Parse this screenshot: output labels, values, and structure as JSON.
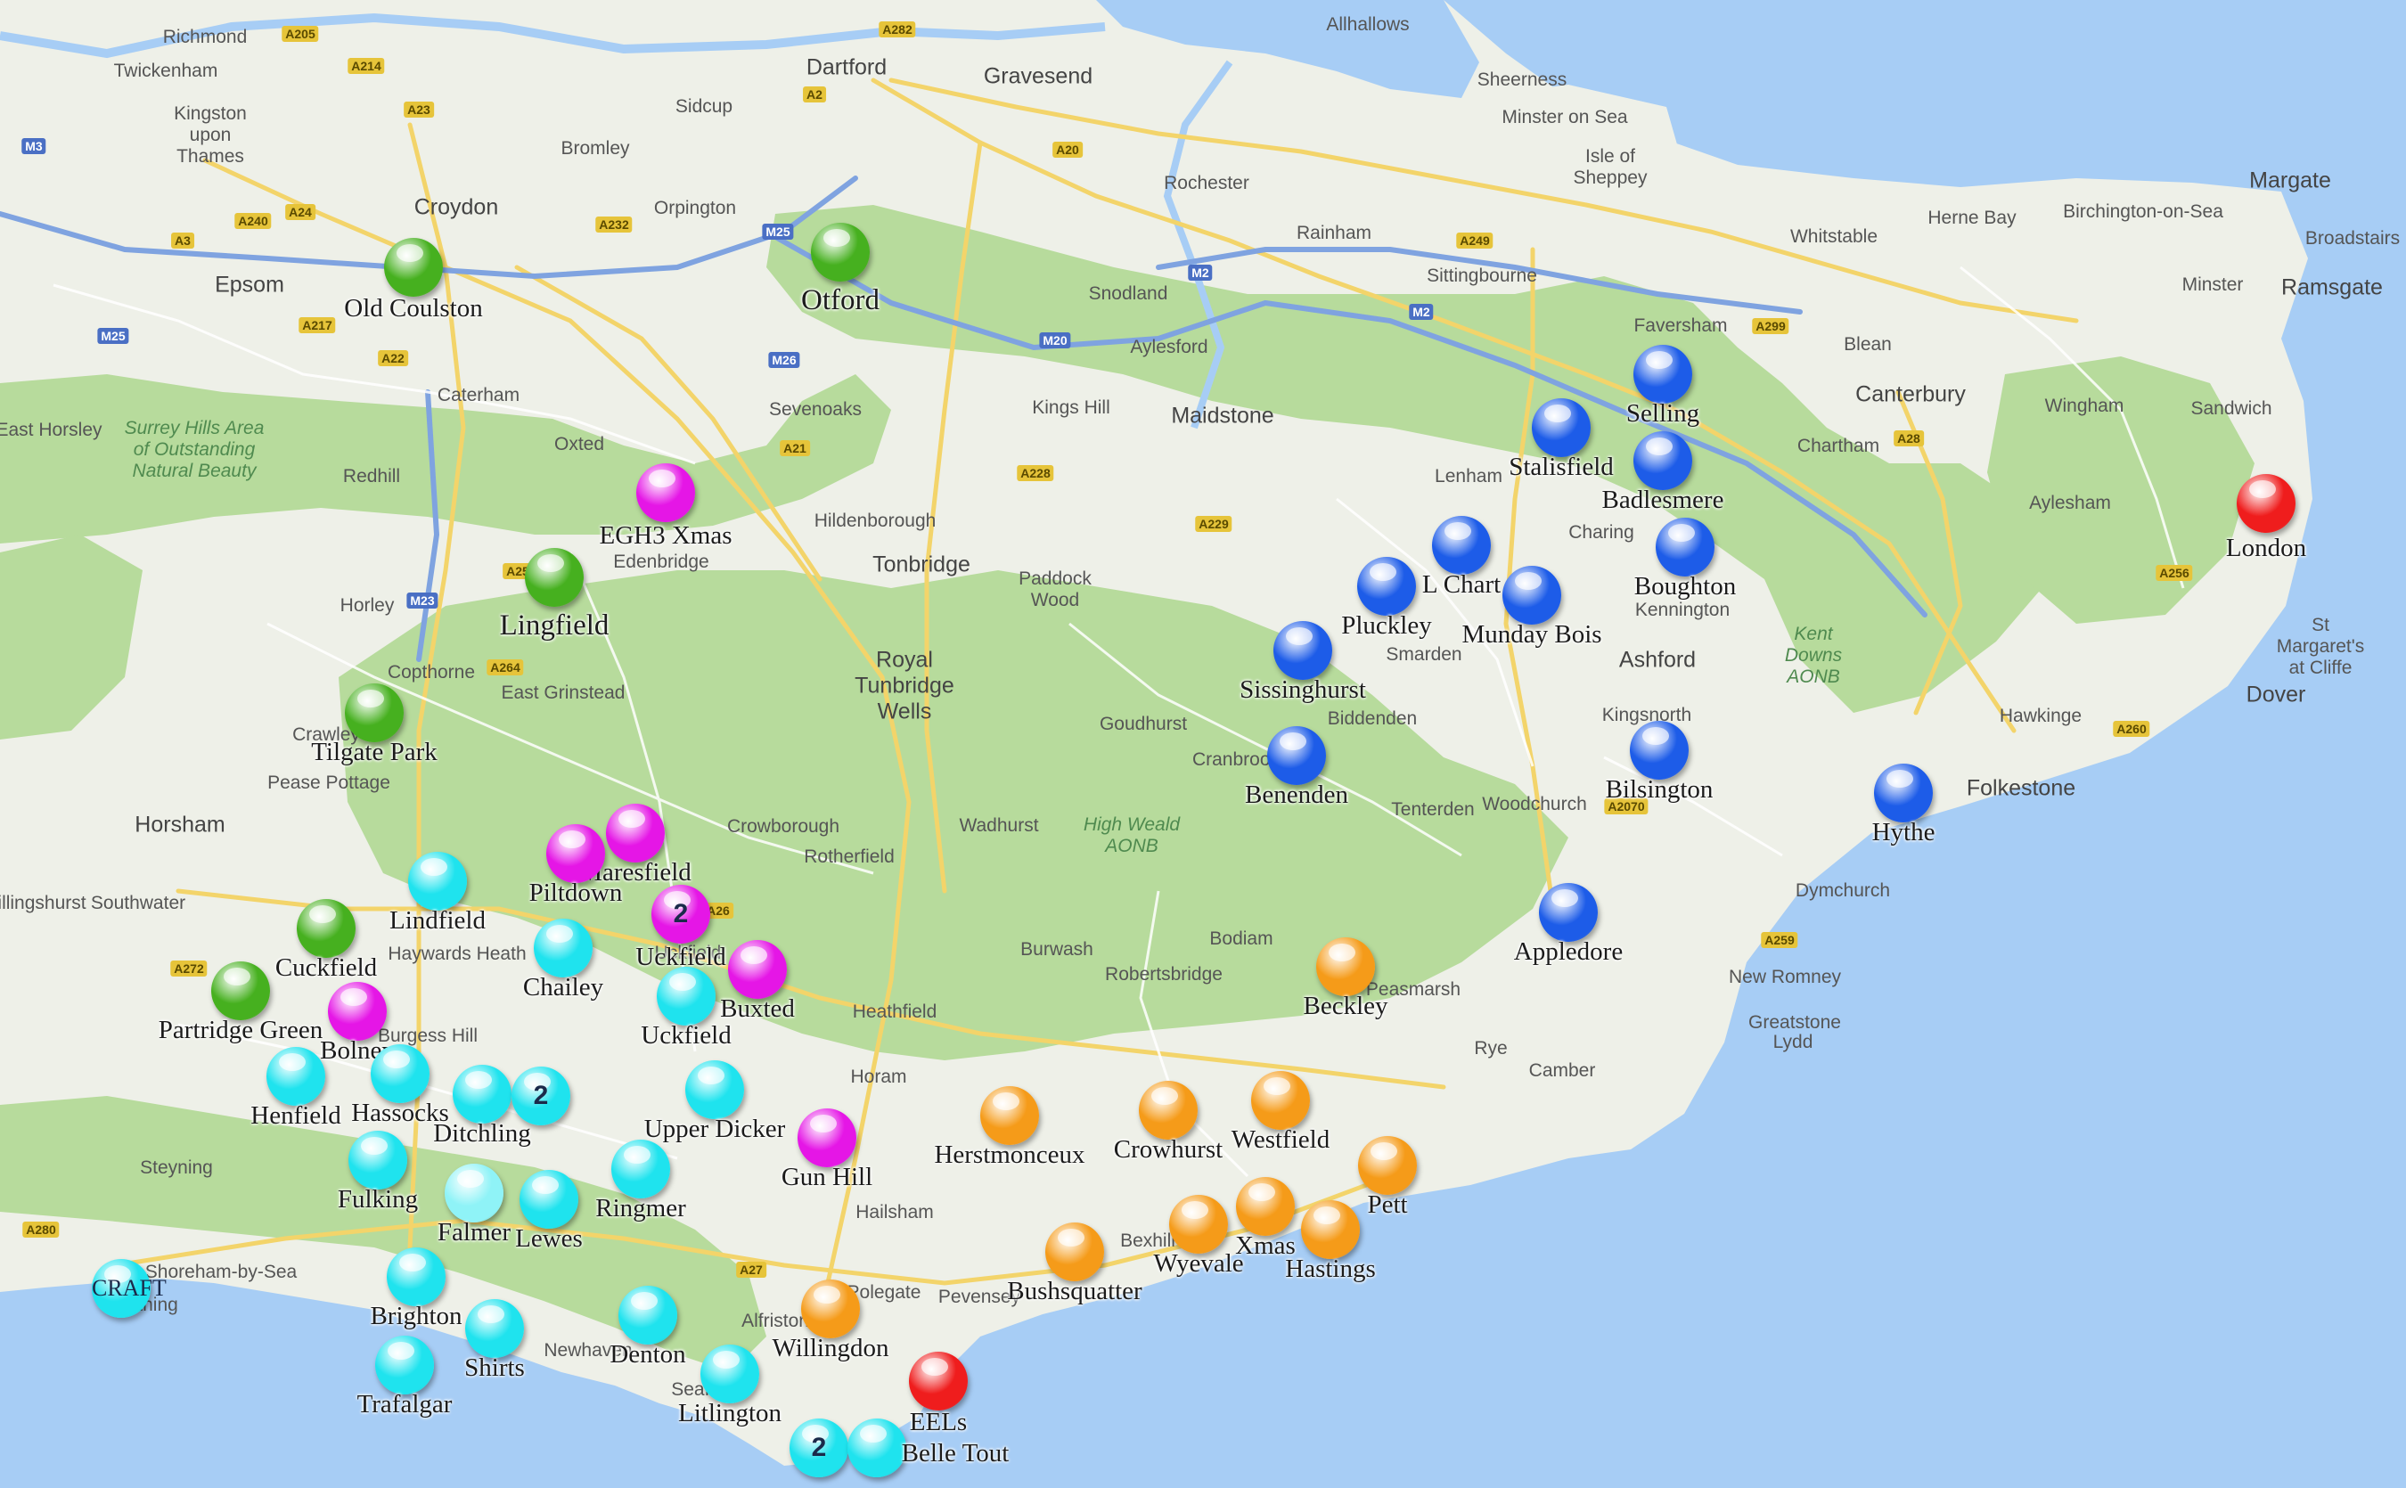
{
  "colors": {
    "sea": "#a7cdf5",
    "land": "#eef0e8",
    "park": "#b7db9c",
    "green": "#46b01f",
    "magenta": "#e516e6",
    "blue": "#1d5ce8",
    "cyan": "#1fe3ee",
    "light_cyan": "#8ff3f7",
    "orange": "#f59b19",
    "red": "#ef1d1d"
  },
  "places": [
    {
      "id": "richmond",
      "text": "Richmond",
      "big": false
    },
    {
      "id": "twickenham",
      "text": "Twickenham",
      "big": false
    },
    {
      "id": "kingston",
      "text": "Kingston upon Thames",
      "big": false
    },
    {
      "id": "bromley",
      "text": "Bromley",
      "big": false
    },
    {
      "id": "croydon",
      "text": "Croydon",
      "big": true
    },
    {
      "id": "epsom",
      "text": "Epsom",
      "big": true
    },
    {
      "id": "dartford",
      "text": "Dartford",
      "big": true
    },
    {
      "id": "gravesend",
      "text": "Gravesend",
      "big": true
    },
    {
      "id": "sidcup",
      "text": "Sidcup",
      "big": false
    },
    {
      "id": "orpington",
      "text": "Orpington",
      "big": false
    },
    {
      "id": "rochester",
      "text": "Rochester",
      "big": false
    },
    {
      "id": "rainham",
      "text": "Rainham",
      "big": false
    },
    {
      "id": "snodland",
      "text": "Snodland",
      "big": false
    },
    {
      "id": "aylesford",
      "text": "Aylesford",
      "big": false
    },
    {
      "id": "maidstone",
      "text": "Maidstone",
      "big": true
    },
    {
      "id": "kings_hill",
      "text": "Kings Hill",
      "big": false
    },
    {
      "id": "sevenoaks",
      "text": "Sevenoaks",
      "big": false
    },
    {
      "id": "sheerness",
      "text": "Sheerness",
      "big": false
    },
    {
      "id": "minster",
      "text": "Minster on Sea",
      "big": false
    },
    {
      "id": "sheppey",
      "text": "Isle of Sheppey",
      "big": false
    },
    {
      "id": "allhallows",
      "text": "Allhallows",
      "big": false
    },
    {
      "id": "sittingbourne",
      "text": "Sittingbourne",
      "big": false
    },
    {
      "id": "faversham",
      "text": "Faversham",
      "big": false
    },
    {
      "id": "whitstable",
      "text": "Whitstable",
      "big": false
    },
    {
      "id": "herne_bay",
      "text": "Herne Bay",
      "big": false
    },
    {
      "id": "birchington",
      "text": "Birchington-on-Sea",
      "big": false
    },
    {
      "id": "margate",
      "text": "Margate",
      "big": true
    },
    {
      "id": "broadstairs",
      "text": "Broadstairs",
      "big": false
    },
    {
      "id": "ramsgate",
      "text": "Ramsgate",
      "big": true
    },
    {
      "id": "minster2",
      "text": "Minster",
      "big": false
    },
    {
      "id": "blean",
      "text": "Blean",
      "big": false
    },
    {
      "id": "canterbury",
      "text": "Canterbury",
      "big": true
    },
    {
      "id": "wingham",
      "text": "Wingham",
      "big": false
    },
    {
      "id": "sandwich",
      "text": "Sandwich",
      "big": false
    },
    {
      "id": "chartham",
      "text": "Chartham",
      "big": false
    },
    {
      "id": "aylesham",
      "text": "Aylesham",
      "big": false
    },
    {
      "id": "lenham",
      "text": "Lenham",
      "big": false
    },
    {
      "id": "charing",
      "text": "Charing",
      "big": false
    },
    {
      "id": "kennington",
      "text": "Kennington",
      "big": false
    },
    {
      "id": "ashford",
      "text": "Ashford",
      "big": true
    },
    {
      "id": "smarden",
      "text": "Smarden",
      "big": false
    },
    {
      "id": "biddenden",
      "text": "Biddenden",
      "big": false
    },
    {
      "id": "kingsnorth",
      "text": "Kingsnorth",
      "big": false
    },
    {
      "id": "hawkinge",
      "text": "Hawkinge",
      "big": false
    },
    {
      "id": "stmargarets",
      "text": "St Margaret's at Cliffe",
      "big": false
    },
    {
      "id": "dover",
      "text": "Dover",
      "big": true
    },
    {
      "id": "folkestone",
      "text": "Folkestone",
      "big": true
    },
    {
      "id": "dymchurch",
      "text": "Dymchurch",
      "big": false
    },
    {
      "id": "new_romney",
      "text": "New Romney",
      "big": false
    },
    {
      "id": "greatstone",
      "text": "Greatstone",
      "big": false
    },
    {
      "id": "lydd",
      "text": "Lydd",
      "big": false
    },
    {
      "id": "camber",
      "text": "Camber",
      "big": false
    },
    {
      "id": "rye",
      "text": "Rye",
      "big": false
    },
    {
      "id": "tenterden",
      "text": "Tenterden",
      "big": false
    },
    {
      "id": "woodchurch",
      "text": "Woodchurch",
      "big": false
    },
    {
      "id": "cranbrook",
      "text": "Cranbrook",
      "big": false
    },
    {
      "id": "goudhurst",
      "text": "Goudhurst",
      "big": false
    },
    {
      "id": "paddock",
      "text": "Paddock Wood",
      "big": false
    },
    {
      "id": "tonbridge",
      "text": "Tonbridge",
      "big": true
    },
    {
      "id": "hildenborough",
      "text": "Hildenborough",
      "big": false
    },
    {
      "id": "tunbridge",
      "text": "Royal Tunbridge Wells",
      "big": true
    },
    {
      "id": "crowborough",
      "text": "Crowborough",
      "big": false
    },
    {
      "id": "rotherfield",
      "text": "Rotherfield",
      "big": false
    },
    {
      "id": "wadhurst",
      "text": "Wadhurst",
      "big": false
    },
    {
      "id": "burwash",
      "text": "Burwash",
      "big": false
    },
    {
      "id": "robertsbridge",
      "text": "Robertsbridge",
      "big": false
    },
    {
      "id": "bodiam",
      "text": "Bodiam",
      "big": false
    },
    {
      "id": "peasmarsh",
      "text": "Peasmarsh",
      "big": false
    },
    {
      "id": "heathfield",
      "text": "Heathfield",
      "big": false
    },
    {
      "id": "horam",
      "text": "Horam",
      "big": false
    },
    {
      "id": "hailsham",
      "text": "Hailsham",
      "big": false
    },
    {
      "id": "polegate",
      "text": "Polegate",
      "big": false
    },
    {
      "id": "pevensey",
      "text": "Pevensey",
      "big": false
    },
    {
      "id": "bexhill",
      "text": "Bexhill",
      "big": false
    },
    {
      "id": "alfriston",
      "text": "Alfriston",
      "big": false
    },
    {
      "id": "seaford",
      "text": "Seaford",
      "big": false
    },
    {
      "id": "newhaven",
      "text": "Newhaven",
      "big": false
    },
    {
      "id": "oxted",
      "text": "Oxted",
      "big": false
    },
    {
      "id": "caterham",
      "text": "Caterham",
      "big": false
    },
    {
      "id": "redhill",
      "text": "Redhill",
      "big": false
    },
    {
      "id": "horley",
      "text": "Horley",
      "big": false
    },
    {
      "id": "edenbridge",
      "text": "Edenbridge",
      "big": false
    },
    {
      "id": "copthorne",
      "text": "Copthorne",
      "big": false
    },
    {
      "id": "east_grinstead",
      "text": "East Grinstead",
      "big": false
    },
    {
      "id": "crawley",
      "text": "Crawley",
      "big": false
    },
    {
      "id": "pease_pottage",
      "text": "Pease Pottage",
      "big": false
    },
    {
      "id": "horsham",
      "text": "Horsham",
      "big": true
    },
    {
      "id": "southwater",
      "text": "Southwater",
      "big": false
    },
    {
      "id": "billingshurst",
      "text": "Billingshurst",
      "big": false
    },
    {
      "id": "haywards",
      "text": "Haywards Heath",
      "big": false
    },
    {
      "id": "burgess",
      "text": "Burgess Hill",
      "big": false
    },
    {
      "id": "steyning",
      "text": "Steyning",
      "big": false
    },
    {
      "id": "shoreham",
      "text": "Shoreham-by-Sea",
      "big": false
    },
    {
      "id": "worthing",
      "text": "Worthing",
      "big": false
    },
    {
      "id": "uckfield_town",
      "text": "Uckfield",
      "big": false
    },
    {
      "id": "high_weald",
      "text": "High Weald AONB",
      "big": false
    },
    {
      "id": "kent_downs",
      "text": "Kent Downs AONB",
      "big": false
    },
    {
      "id": "surrey_hills",
      "text": "Surrey Hills Area of Outstanding Natural Beauty",
      "big": false
    },
    {
      "id": "horsley",
      "text": "East Horsley",
      "big": false
    }
  ],
  "roads": [
    {
      "id": "r_a205",
      "text": "A205",
      "type": "a"
    },
    {
      "id": "r_a214",
      "text": "A214",
      "type": "a"
    },
    {
      "id": "r_a23a",
      "text": "A23",
      "type": "a"
    },
    {
      "id": "r_a24",
      "text": "A24",
      "type": "a"
    },
    {
      "id": "r_a240",
      "text": "A240",
      "type": "a"
    },
    {
      "id": "r_a232",
      "text": "A232",
      "type": "a"
    },
    {
      "id": "r_a3",
      "text": "A3",
      "type": "a"
    },
    {
      "id": "r_a217",
      "text": "A217",
      "type": "a"
    },
    {
      "id": "r_a22",
      "text": "A22",
      "type": "a"
    },
    {
      "id": "r_a282",
      "text": "A282",
      "type": "a"
    },
    {
      "id": "r_a2",
      "text": "A2",
      "type": "a"
    },
    {
      "id": "r_a20",
      "text": "A20",
      "type": "a"
    },
    {
      "id": "r_a21",
      "text": "A21",
      "type": "a"
    },
    {
      "id": "r_a228",
      "text": "A228",
      "type": "a"
    },
    {
      "id": "r_a229",
      "text": "A229",
      "type": "a"
    },
    {
      "id": "r_a249",
      "text": "A249",
      "type": "a"
    },
    {
      "id": "r_a299",
      "text": "A299",
      "type": "a"
    },
    {
      "id": "r_a28",
      "text": "A28",
      "type": "a"
    },
    {
      "id": "r_a256",
      "text": "A256",
      "type": "a"
    },
    {
      "id": "r_a260",
      "text": "A260",
      "type": "a"
    },
    {
      "id": "r_a259",
      "text": "A259",
      "type": "a"
    },
    {
      "id": "r_a2070",
      "text": "A2070",
      "type": "a"
    },
    {
      "id": "r_a264",
      "text": "A264",
      "type": "a"
    },
    {
      "id": "r_a272",
      "text": "A272",
      "type": "a"
    },
    {
      "id": "r_a27",
      "text": "A27",
      "type": "a"
    },
    {
      "id": "r_a26",
      "text": "A26",
      "type": "a"
    },
    {
      "id": "r_a280",
      "text": "A280",
      "type": "a"
    },
    {
      "id": "r_a25",
      "text": "A25",
      "type": "a"
    },
    {
      "id": "r_m25a",
      "text": "M25",
      "type": "m"
    },
    {
      "id": "r_m25b",
      "text": "M25",
      "type": "m"
    },
    {
      "id": "r_m3",
      "text": "M3",
      "type": "m"
    },
    {
      "id": "r_m23",
      "text": "M23",
      "type": "m"
    },
    {
      "id": "r_m20",
      "text": "M20",
      "type": "m"
    },
    {
      "id": "r_m26",
      "text": "M26",
      "type": "m"
    },
    {
      "id": "r_m2",
      "text": "M2",
      "type": "m"
    },
    {
      "id": "r_m2b",
      "text": "M2",
      "type": "m"
    }
  ],
  "markers": [
    {
      "id": "old-coulston",
      "label": "Old Coulston",
      "color": "green"
    },
    {
      "id": "otford",
      "label": "Otford",
      "color": "green"
    },
    {
      "id": "lingfield",
      "label": "Lingfield",
      "color": "green"
    },
    {
      "id": "tilgate-park",
      "label": "Tilgate Park",
      "color": "green"
    },
    {
      "id": "cuckfield",
      "label": "Cuckfield",
      "color": "green"
    },
    {
      "id": "partridge-green",
      "label": "Partridge Green",
      "color": "green"
    },
    {
      "id": "egh3-xmas",
      "label": "EGH3 Xmas",
      "color": "magenta"
    },
    {
      "id": "maresfield",
      "label": "Maresfield",
      "color": "magenta"
    },
    {
      "id": "piltdown",
      "label": "Piltdown",
      "color": "magenta"
    },
    {
      "id": "uckfield-cluster",
      "label": "Uckfield",
      "color": "magenta",
      "count": "2"
    },
    {
      "id": "buxted",
      "label": "Buxted",
      "color": "magenta"
    },
    {
      "id": "bolney",
      "label": "Bolney",
      "color": "magenta"
    },
    {
      "id": "gun-hill",
      "label": "Gun Hill",
      "color": "magenta"
    },
    {
      "id": "selling",
      "label": "Selling",
      "color": "blue"
    },
    {
      "id": "stalisfield",
      "label": "Stalisfield",
      "color": "blue"
    },
    {
      "id": "badlesmere",
      "label": "Badlesmere",
      "color": "blue"
    },
    {
      "id": "l-chart",
      "label": "L Chart",
      "color": "blue"
    },
    {
      "id": "pluckley",
      "label": "Pluckley",
      "color": "blue"
    },
    {
      "id": "munday-bois",
      "label": "Munday Bois",
      "color": "blue"
    },
    {
      "id": "boughton",
      "label": "Boughton",
      "color": "blue"
    },
    {
      "id": "sissinghurst",
      "label": "Sissinghurst",
      "color": "blue"
    },
    {
      "id": "benenden",
      "label": "Benenden",
      "color": "blue"
    },
    {
      "id": "bilsington",
      "label": "Bilsington",
      "color": "blue"
    },
    {
      "id": "hythe",
      "label": "Hythe",
      "color": "blue"
    },
    {
      "id": "appledore",
      "label": "Appledore",
      "color": "blue"
    },
    {
      "id": "london",
      "label": "London",
      "color": "red"
    },
    {
      "id": "eels",
      "label": "EELs",
      "color": "red"
    },
    {
      "id": "lindfield",
      "label": "Lindfield",
      "color": "cyan"
    },
    {
      "id": "chailey",
      "label": "Chailey",
      "color": "cyan"
    },
    {
      "id": "uckfield",
      "label": "Uckfield",
      "color": "cyan"
    },
    {
      "id": "henfield",
      "label": "Henfield",
      "color": "cyan"
    },
    {
      "id": "hassocks",
      "label": "Hassocks",
      "color": "cyan"
    },
    {
      "id": "ditchling",
      "label": "Ditchling",
      "color": "cyan"
    },
    {
      "id": "ditchling-cluster",
      "label": "",
      "color": "cyan",
      "count": "2"
    },
    {
      "id": "upper-dicker",
      "label": "Upper Dicker",
      "color": "cyan"
    },
    {
      "id": "fulking",
      "label": "Fulking",
      "color": "cyan"
    },
    {
      "id": "falmer",
      "label": "Falmer",
      "color": "light_cyan"
    },
    {
      "id": "lewes",
      "label": "Lewes",
      "color": "cyan"
    },
    {
      "id": "ringmer",
      "label": "Ringmer",
      "color": "cyan"
    },
    {
      "id": "craft",
      "label": "CRAFT",
      "color": "cyan",
      "inside": true
    },
    {
      "id": "brighton",
      "label": "Brighton",
      "color": "cyan"
    },
    {
      "id": "shirts",
      "label": "Shirts",
      "color": "cyan"
    },
    {
      "id": "trafalgar",
      "label": "Trafalgar",
      "color": "cyan"
    },
    {
      "id": "denton",
      "label": "Denton",
      "color": "cyan"
    },
    {
      "id": "litlington",
      "label": "Litlington",
      "color": "cyan"
    },
    {
      "id": "belle-tout-cluster",
      "label": "",
      "color": "cyan",
      "count": "2"
    },
    {
      "id": "belle-tout",
      "label": "Belle Tout",
      "color": "cyan"
    },
    {
      "id": "beckley",
      "label": "Beckley",
      "color": "orange"
    },
    {
      "id": "herstmonceux",
      "label": "Herstmonceux",
      "color": "orange"
    },
    {
      "id": "crowhurst",
      "label": "Crowhurst",
      "color": "orange"
    },
    {
      "id": "westfield",
      "label": "Westfield",
      "color": "orange"
    },
    {
      "id": "pett",
      "label": "Pett",
      "color": "orange"
    },
    {
      "id": "xmas",
      "label": "Xmas",
      "color": "orange"
    },
    {
      "id": "hastings",
      "label": "Hastings",
      "color": "orange"
    },
    {
      "id": "wyevale",
      "label": "Wyevale",
      "color": "orange"
    },
    {
      "id": "bushsquatter",
      "label": "Bushsquatter",
      "color": "orange"
    },
    {
      "id": "willingdon",
      "label": "Willingdon",
      "color": "orange"
    }
  ]
}
